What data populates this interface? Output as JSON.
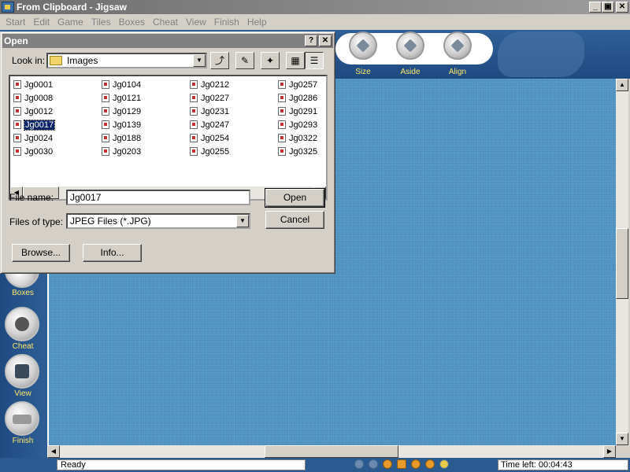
{
  "window": {
    "title": "From Clipboard - Jigsaw",
    "min": "_",
    "max": "▣",
    "close": "✕"
  },
  "menu": [
    "Start",
    "Edit",
    "Game",
    "Tiles",
    "Boxes",
    "Cheat",
    "View",
    "Finish",
    "Help"
  ],
  "toolbar": {
    "size": "Size",
    "aside": "Aside",
    "align": "Align"
  },
  "sidebar": {
    "boxes": "Boxes",
    "cheat": "Cheat",
    "view": "View",
    "finish": "Finish"
  },
  "dialog": {
    "title": "Open",
    "help_btn": "?",
    "close_btn": "✕",
    "lookin_label": "Look in:",
    "lookin_value": "Images",
    "files": [
      [
        "Jg0001",
        "Jg0008",
        "Jg0012",
        "Jg0017",
        "Jg0024",
        "Jg0030"
      ],
      [
        "Jg0104",
        "Jg0121",
        "Jg0129",
        "Jg0139",
        "Jg0188",
        "Jg0203"
      ],
      [
        "Jg0212",
        "Jg0227",
        "Jg0231",
        "Jg0247",
        "Jg0254",
        "Jg0255"
      ],
      [
        "Jg0257",
        "Jg0286",
        "Jg0291",
        "Jg0293",
        "Jg0322",
        "Jg0325"
      ]
    ],
    "selected_file": "Jg0017",
    "filename_label": "File name:",
    "filename_value": "Jg0017",
    "filetype_label": "Files of type:",
    "filetype_value": "JPEG Files (*.JPG)",
    "open_btn": "Open",
    "cancel_btn": "Cancel",
    "browse_btn": "Browse...",
    "info_btn": "Info..."
  },
  "status": {
    "ready": "Ready",
    "time_left": "Time left:  00:04:43"
  }
}
